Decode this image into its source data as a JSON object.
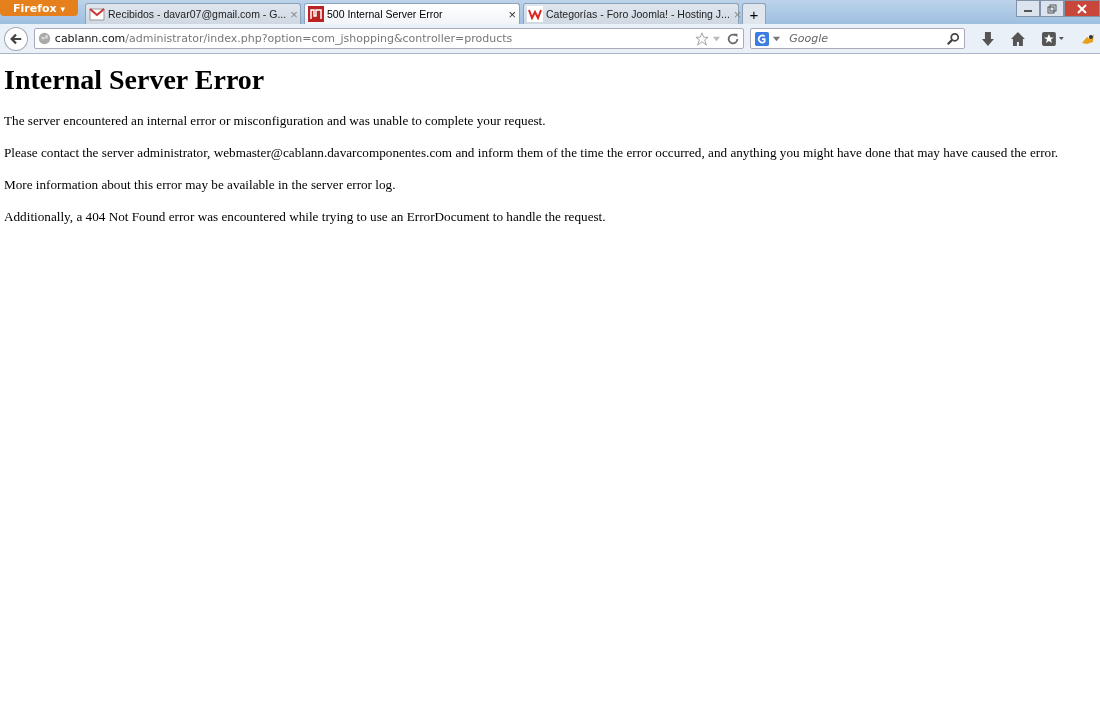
{
  "app_button": {
    "label": "Firefox",
    "caret": "▾"
  },
  "tab_close": "×",
  "tabs": [
    {
      "title": "Recibidos - davar07@gmail.com - G...",
      "selected": false,
      "kind": "mail"
    },
    {
      "title": "500 Internal Server Error",
      "selected": true,
      "kind": "site"
    },
    {
      "title": "Categorías - Foro Joomla! - Hosting J...",
      "selected": false,
      "kind": "forum"
    }
  ],
  "new_tab": {
    "label": "+"
  },
  "url": {
    "domain": "cablann.com",
    "path": "/administrator/index.php?option=com_jshopping&controller=products"
  },
  "search": {
    "placeholder": "Google"
  },
  "page": {
    "heading": "Internal Server Error",
    "paragraphs": [
      "The server encountered an internal error or misconfiguration and was unable to complete your request.",
      "Please contact the server administrator, webmaster@cablann.davarcomponentes.com and inform them of the time the error occurred, and anything you might have done that may have caused the error.",
      "More information about this error may be available in the server error log.",
      "Additionally, a 404 Not Found error was encountered while trying to use an ErrorDocument to handle the request."
    ]
  }
}
